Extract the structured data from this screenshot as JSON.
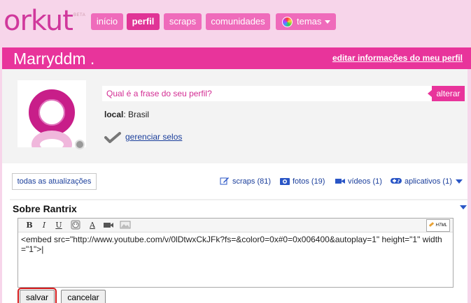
{
  "header": {
    "logo": "orkut",
    "beta": "BETA",
    "nav": [
      {
        "label": "início",
        "active": false
      },
      {
        "label": "perfil",
        "active": true
      },
      {
        "label": "scraps",
        "active": false
      },
      {
        "label": "comunidades",
        "active": false
      },
      {
        "label": "temas",
        "active": false
      }
    ]
  },
  "profile": {
    "name": "Marryddm   .",
    "edit_link": "editar informações do meu perfil",
    "phrase_prompt": "Qual é a frase do seu perfil?",
    "alterar": "alterar",
    "local_label": "local",
    "local_value": ": Brasil",
    "selos_link": "gerenciar selos"
  },
  "updates": {
    "button": "todas as atualizações",
    "stats": [
      {
        "label": "scraps (81)",
        "icon": "pencil-icon"
      },
      {
        "label": "fotos (19)",
        "icon": "camera-icon"
      },
      {
        "label": "vídeos (1)",
        "icon": "video-icon"
      },
      {
        "label": "aplicativos (1)",
        "icon": "gamepad-icon"
      }
    ]
  },
  "sobre": {
    "title": "Sobre Rantrix",
    "toolbar": {
      "bold": "B",
      "italic": "I",
      "underline": "U",
      "color": "A",
      "html": "HTML"
    },
    "content": "<embed src=\"http://www.youtube.com/v/0lDtwxCkJFk?fs=&color0=0x#0=0x006400&autoplay=1\" height=\"1\" width=\"1\">|",
    "save": "salvar",
    "cancel": "cancelar"
  },
  "colors": {
    "brand_pink": "#e8349b",
    "light_pink": "#f7d5ea",
    "link_blue": "#1a3e9b"
  }
}
